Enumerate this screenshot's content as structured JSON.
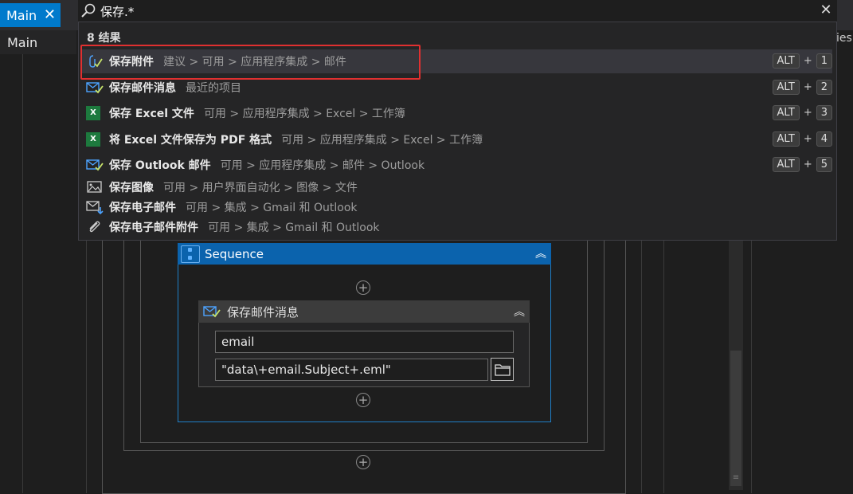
{
  "tabs": {
    "main_label": "Main",
    "close_glyph": "✕"
  },
  "breadcrumb": "Main",
  "right_fragment": "ies.",
  "search": {
    "value": "保存.*",
    "close_glyph": "✕",
    "results_count": "8 结果"
  },
  "results": [
    {
      "name": "保存附件",
      "path": "建议 > 可用 > 应用程序集成 > 邮件",
      "icon": "attachment-check-icon",
      "key": "1"
    },
    {
      "name": "保存邮件消息",
      "path": "最近的项目",
      "icon": "mail-check-icon",
      "key": "2"
    },
    {
      "name": "保存 Excel 文件",
      "path": "可用 > 应用程序集成 > Excel > 工作簿",
      "icon": "excel-icon",
      "key": "3"
    },
    {
      "name": "将 Excel 文件保存为 PDF 格式",
      "path": "可用 > 应用程序集成 > Excel > 工作簿",
      "icon": "excel-icon",
      "key": "4"
    },
    {
      "name": "保存 Outlook 邮件",
      "path": "可用 > 应用程序集成 > 邮件 > Outlook",
      "icon": "mail-check-icon",
      "key": "5"
    },
    {
      "name": "保存图像",
      "path": "可用 > 用户界面自动化 > 图像 > 文件",
      "icon": "image-icon"
    },
    {
      "name": "保存电子邮件",
      "path": "可用 > 集成 > Gmail 和 Outlook",
      "icon": "mail-download-icon"
    },
    {
      "name": "保存电子邮件附件",
      "path": "可用 > 集成 > Gmail 和 Outlook",
      "icon": "paperclip-icon"
    }
  ],
  "shortcut": {
    "alt": "ALT",
    "plus": "+"
  },
  "sequence": {
    "label": "Sequence",
    "collapse_glyph": "︽"
  },
  "activity": {
    "label": "保存邮件消息",
    "collapse_glyph": "︽",
    "email_value": "email",
    "path_value": "\"data\\+email.Subject+.eml\""
  },
  "add_glyph": "+",
  "colors": {
    "accent": "#007acc",
    "sequence_header": "#0b63ad",
    "highlight": "#e03030",
    "excel": "#1d7a3e"
  }
}
